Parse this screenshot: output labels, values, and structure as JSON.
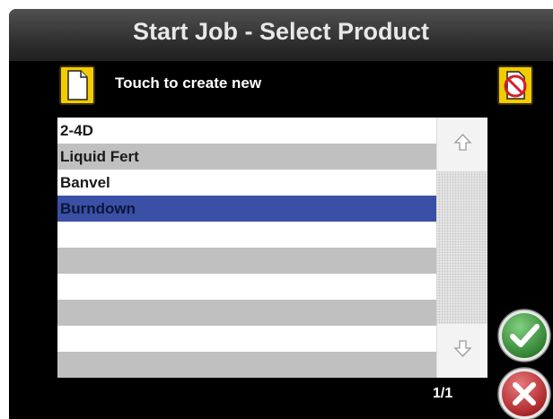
{
  "header": {
    "title": "Start Job - Select Product"
  },
  "toolbar": {
    "create_label": "Touch to create new"
  },
  "products": {
    "rows": [
      {
        "label": "2-4D",
        "selected": false
      },
      {
        "label": "Liquid Fert",
        "selected": false
      },
      {
        "label": "Banvel",
        "selected": false
      },
      {
        "label": "Burndown",
        "selected": true
      },
      {
        "label": "",
        "selected": false
      },
      {
        "label": "",
        "selected": false
      },
      {
        "label": "",
        "selected": false
      },
      {
        "label": "",
        "selected": false
      },
      {
        "label": "",
        "selected": false
      },
      {
        "label": "",
        "selected": false
      }
    ]
  },
  "pagination": {
    "indicator": "1/1"
  },
  "icons": {
    "create": "new-document-icon",
    "delete": "no-document-icon",
    "scroll_up": "arrow-up-icon",
    "scroll_down": "arrow-down-icon",
    "accept": "checkmark-icon",
    "cancel": "x-icon"
  },
  "colors": {
    "accent_yellow": "#f2cc00",
    "selection": "#3a50a6",
    "accept_green": "#3c9a3c",
    "cancel_red": "#c8383c"
  }
}
